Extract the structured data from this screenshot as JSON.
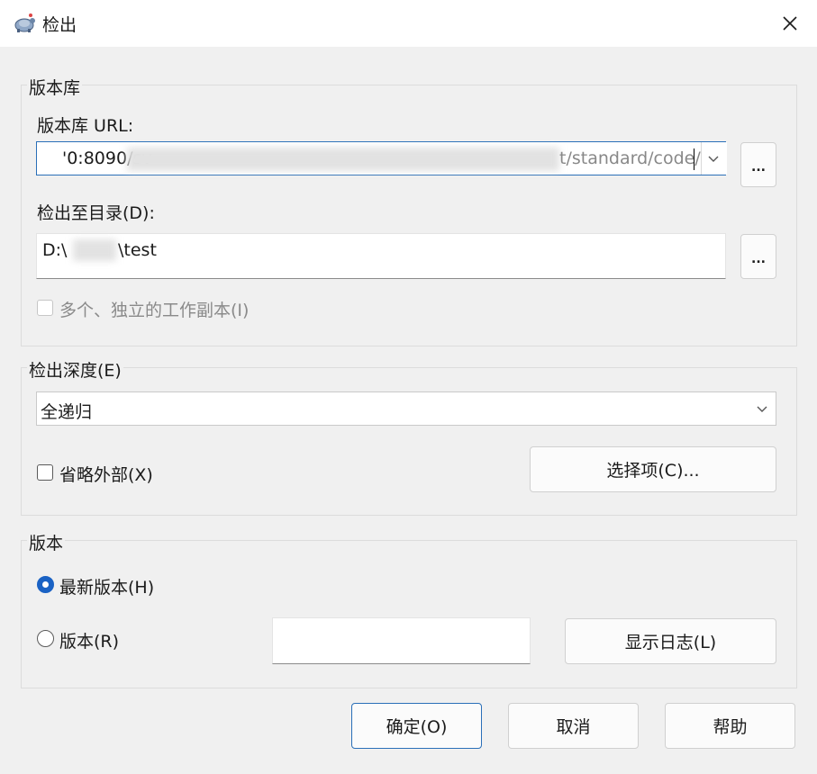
{
  "window": {
    "title": "检出",
    "app_icon": "tortoise-icon",
    "close_icon": "close-icon"
  },
  "repository": {
    "group_label": "版本库",
    "url_label": "版本库 URL:",
    "url_value_left": "'0:8090/sv",
    "url_value_right": "t/standard/code/",
    "browse_label": "...",
    "checkout_dir_label": "检出至目录(D):",
    "checkout_dir_prefix": "D:\\",
    "checkout_dir_suffix": "\\test",
    "browse_dir_label": "...",
    "multiple_copies_label": "多个、独立的工作副本(I)",
    "multiple_copies_checked": false,
    "multiple_copies_enabled": false
  },
  "depth": {
    "group_label": "检出深度(E)",
    "selected": "全递归",
    "omit_externals_label": "省略外部(X)",
    "omit_externals_checked": false,
    "items_button": "选择项(C)..."
  },
  "revision": {
    "group_label": "版本",
    "head_label": "最新版本(H)",
    "head_selected": true,
    "revision_label": "版本(R)",
    "revision_value": "",
    "show_log_button": "显示日志(L)"
  },
  "buttons": {
    "ok": "确定(O)",
    "cancel": "取消",
    "help": "帮助"
  },
  "colors": {
    "accent": "#1a62c4",
    "focus_border": "#2a6fb8",
    "background": "#f0f0f0"
  }
}
